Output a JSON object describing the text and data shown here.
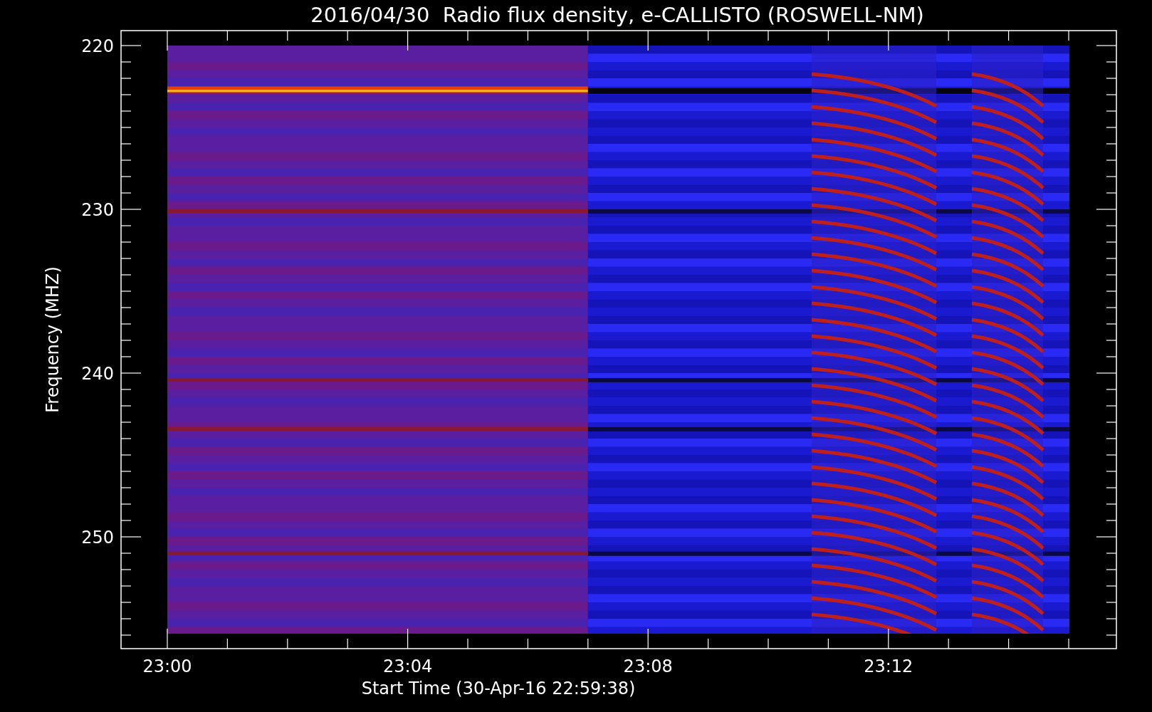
{
  "title": "2016/04/30  Radio flux density, e-CALLISTO (ROSWELL-NM)",
  "y_axis": {
    "label": "Frequency (MHZ)",
    "tick_labels": [
      "220",
      "230",
      "240",
      "250"
    ]
  },
  "x_axis": {
    "label": "Start Time (30-Apr-16 22:59:38)",
    "tick_labels": [
      "23:00",
      "23:04",
      "23:08",
      "23:12"
    ]
  }
}
